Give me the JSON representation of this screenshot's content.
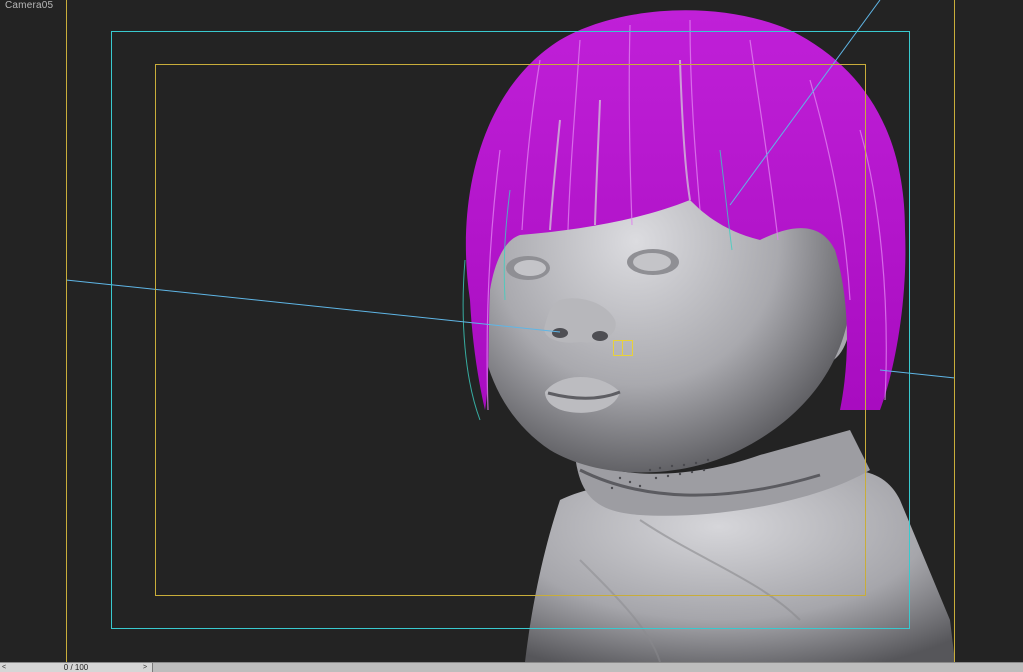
{
  "viewport": {
    "camera_label": "Camera05",
    "frame_colors": {
      "render": "#c8ad3a",
      "action_safe": "#39c9cf",
      "title_safe": "#c8ad3a"
    },
    "hair_color": "#b012c8",
    "skin_color": "#c8c8cc"
  },
  "timeline": {
    "slider_label": "0 / 100",
    "prev_icon": "<",
    "next_icon": ">"
  }
}
